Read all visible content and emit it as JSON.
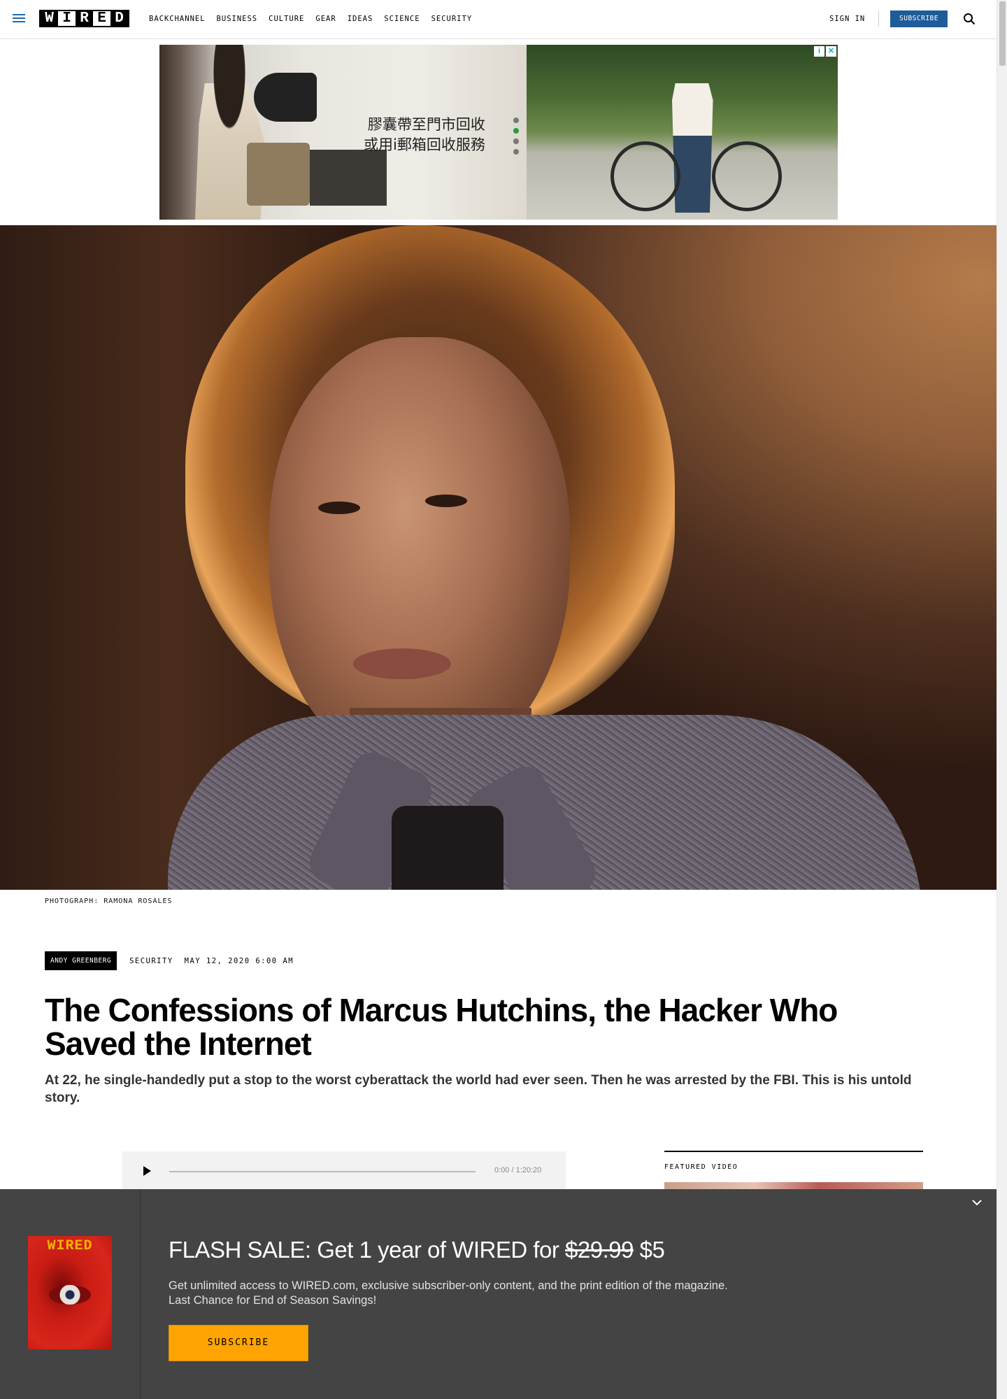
{
  "nav": {
    "logo_letters": [
      "W",
      "I",
      "R",
      "E",
      "D"
    ],
    "links": [
      "BACKCHANNEL",
      "BUSINESS",
      "CULTURE",
      "GEAR",
      "IDEAS",
      "SCIENCE",
      "SECURITY"
    ],
    "sign_in": "SIGN IN",
    "subscribe": "SUBSCRIBE",
    "accent_color": "#1d5c99"
  },
  "ad": {
    "text_line1": "膠囊帶至門市回收",
    "text_line2": "或用i郵箱回收服務"
  },
  "hero": {
    "credit": "PHOTOGRAPH: RAMONA ROSALES"
  },
  "article": {
    "author": "ANDY GREENBERG",
    "category": "SECURITY",
    "date": "MAY 12, 2020 6:00 AM",
    "title": "The Confessions of Marcus Hutchins, the Hacker Who Saved the Internet",
    "dek": "At 22, he single-handedly put a stop to the worst cyberattack the world had ever seen. Then he was arrested by the FBI. This is his untold story."
  },
  "audio": {
    "time": "0:00 / 1:20:20"
  },
  "featured_video": {
    "label": "FEATURED VIDEO"
  },
  "promo": {
    "cover_logo": "WIRED",
    "title_prefix": "FLASH SALE: Get 1 year of WIRED for ",
    "old_price": "$29.99",
    "new_price": " $5",
    "desc_line1": "Get unlimited access to WIRED.com, exclusive subscriber-only content, and the print edition of the magazine.",
    "desc_line2": "Last Chance for End of Season Savings!",
    "button": "SUBSCRIBE",
    "button_color": "#ffa400"
  }
}
